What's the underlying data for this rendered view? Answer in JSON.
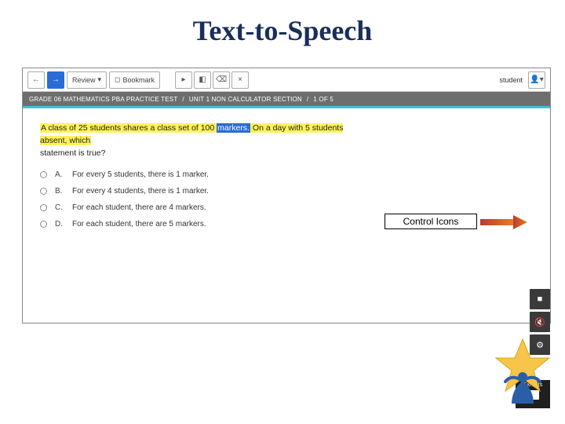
{
  "title": "Text-to-Speech",
  "toolbar": {
    "prev": "←",
    "next": "→",
    "review": "Review",
    "bookmark": "Bookmark",
    "pointer": "",
    "flag": "",
    "eraser": "",
    "close": "×",
    "user": "student",
    "user_icon": "▾"
  },
  "breadcrumb": {
    "a": "GRADE 06 MATHEMATICS PBA PRACTICE TEST",
    "b": "UNIT 1  NON CALCULATOR SECTION",
    "c": "1 OF 5"
  },
  "question": {
    "pre": "A class of 25 students shares a class set of 100",
    "sel": "markers.",
    "post": " On a day with 5 students absent, which",
    "line2": "statement is true?"
  },
  "options": [
    {
      "letter": "A.",
      "text": "For every 5 students, there is 1 marker."
    },
    {
      "letter": "B.",
      "text": "For every 4 students, there is 1 marker."
    },
    {
      "letter": "C.",
      "text": "For each student, there are 4 markers."
    },
    {
      "letter": "D.",
      "text": "For each student, there are 5 markers."
    }
  ],
  "controlLabel": "Control Icons",
  "side": {
    "stop": "■",
    "volume": "🔇",
    "settings": "⚙"
  },
  "exhibits": {
    "label": "Exhibits"
  }
}
